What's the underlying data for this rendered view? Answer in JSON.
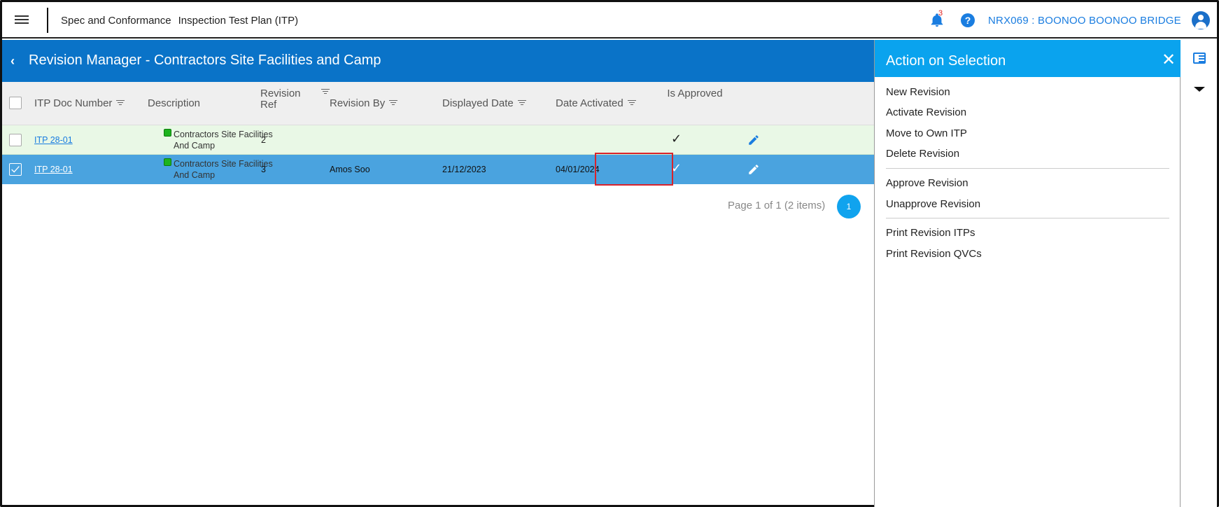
{
  "app": {
    "module": "Spec and Conformance",
    "page": "Inspection Test Plan (ITP)",
    "notification_count": "3",
    "help_label": "?",
    "project": "NRX069 : BOONOO BOONOO BRIDGE"
  },
  "main": {
    "title": "Revision Manager - Contractors Site Facilities and Camp",
    "columns": {
      "itp_doc_number": "ITP Doc Number",
      "description": "Description",
      "revision_ref": "Revision Ref",
      "revision_by": "Revision By",
      "displayed_date": "Displayed Date",
      "date_activated": "Date Activated",
      "is_approved": "Is Approved"
    },
    "rows": [
      {
        "itp": "ITP 28-01",
        "description": "Contractors Site Facilities And Camp",
        "revision_ref": "2",
        "revision_by": "",
        "displayed_date": "",
        "date_activated": "",
        "approved": "✓",
        "selected": false
      },
      {
        "itp": "ITP 28-01",
        "description": "Contractors Site Facilities And Camp",
        "revision_ref": "3",
        "revision_by": "Amos Soo",
        "displayed_date": "21/12/2023",
        "date_activated": "04/01/2024",
        "approved": "✓",
        "selected": true
      }
    ],
    "pager": {
      "text": "Page 1 of 1 (2 items)",
      "current": "1"
    }
  },
  "panel": {
    "title": "Action on Selection",
    "close_label": "✕",
    "group1": [
      "New Revision",
      "Activate Revision",
      "Move to Own ITP",
      "Delete Revision"
    ],
    "group2": [
      "Approve Revision",
      "Unapprove Revision"
    ],
    "group3": [
      "Print Revision ITPs",
      "Print Revision QVCs"
    ]
  },
  "colors": {
    "header_blue": "#0a73c8",
    "panel_blue": "#0aa3ee",
    "selected_row": "#4aa3df",
    "approved_row": "#e9f8e6",
    "highlight_red": "#d9232b"
  }
}
